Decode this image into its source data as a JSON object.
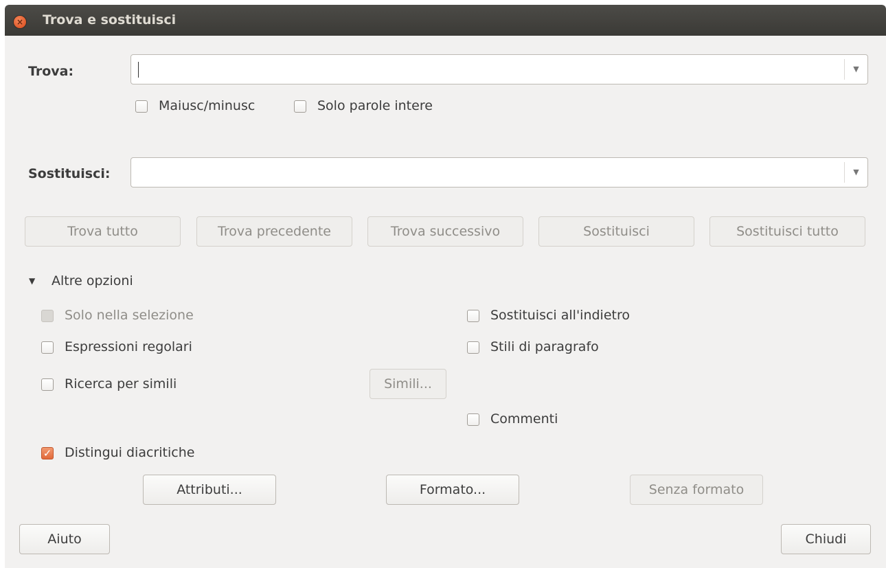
{
  "window": {
    "title": "Trova e sostituisci",
    "close_icon": "close-icon"
  },
  "find": {
    "label": "Trova:",
    "value": "",
    "dropdown_icon": "chevron-down-icon"
  },
  "find_options": {
    "match_case": {
      "label": "Maiusc/minusc",
      "checked": false
    },
    "whole_words": {
      "label": "Solo parole intere",
      "checked": false
    }
  },
  "replace": {
    "label": "Sostituisci:",
    "value": "",
    "dropdown_icon": "chevron-down-icon"
  },
  "action_buttons": {
    "find_all": "Trova tutto",
    "find_previous": "Trova precedente",
    "find_next": "Trova successivo",
    "replace": "Sostituisci",
    "replace_all": "Sostituisci tutto"
  },
  "more_options": {
    "label": "Altre opzioni",
    "expanded": true,
    "selection_only": {
      "label": "Solo nella selezione",
      "checked": false,
      "enabled": false
    },
    "regex": {
      "label": "Espressioni regolari",
      "checked": false
    },
    "similarity": {
      "label": "Ricerca per simili",
      "checked": false
    },
    "similarity_button": "Simili...",
    "replace_backwards": {
      "label": "Sostituisci all'indietro",
      "checked": false
    },
    "paragraph_styles": {
      "label": "Stili di paragrafo",
      "checked": false
    },
    "comments": {
      "label": "Commenti",
      "checked": false
    },
    "diacritics": {
      "label": "Distingui diacritiche",
      "checked": true
    },
    "attributes_button": "Attributi...",
    "format_button": "Formato...",
    "no_format_button": "Senza formato"
  },
  "footer": {
    "help": "Aiuto",
    "close": "Chiudi"
  },
  "colors": {
    "accent": "#e2693a",
    "titlebar": "#3c3b37",
    "background": "#f2f1f0"
  }
}
